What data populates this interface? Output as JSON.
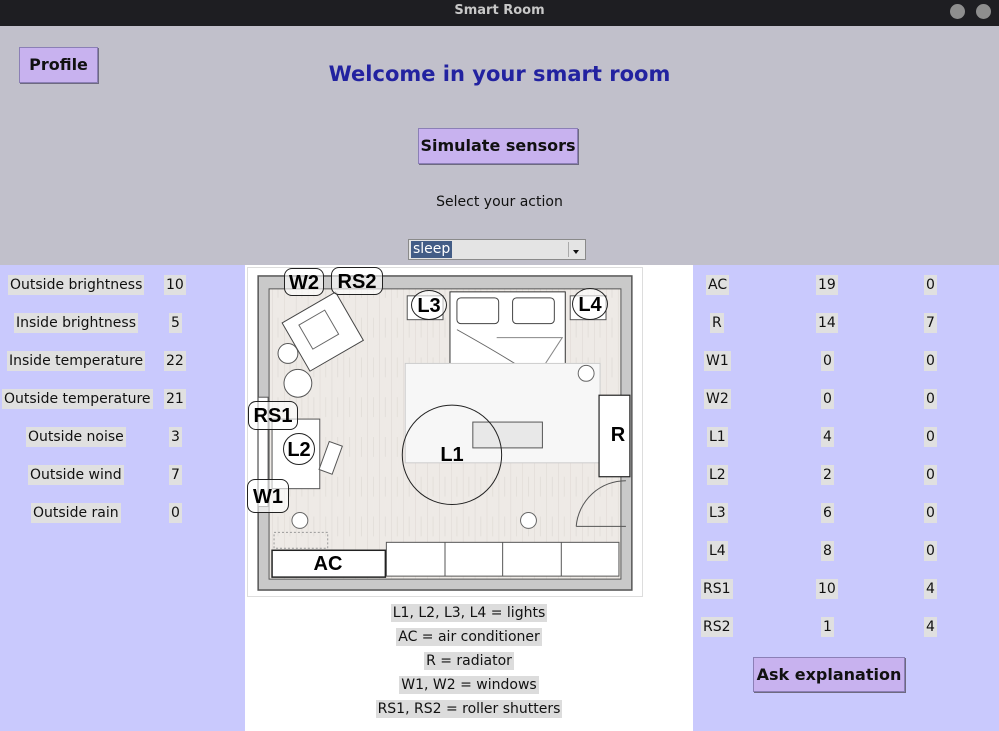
{
  "window": {
    "title": "Smart Room"
  },
  "header": {
    "profile_label": "Profile",
    "welcome": "Welcome in your smart room",
    "simulate_label": "Simulate sensors",
    "select_label": "Select your action",
    "action_selected": "sleep"
  },
  "sensors": [
    {
      "label": "Outside brightness",
      "value": "10"
    },
    {
      "label": "Inside brightness",
      "value": "5"
    },
    {
      "label": "Inside temperature",
      "value": "22"
    },
    {
      "label": "Outside temperature",
      "value": "21"
    },
    {
      "label": "Outside noise",
      "value": "3"
    },
    {
      "label": "Outside wind",
      "value": "7"
    },
    {
      "label": "Outside rain",
      "value": "0"
    }
  ],
  "devices": [
    {
      "name": "AC",
      "value1": "19",
      "value2": "0"
    },
    {
      "name": "R",
      "value1": "14",
      "value2": "7"
    },
    {
      "name": "W1",
      "value1": "0",
      "value2": "0"
    },
    {
      "name": "W2",
      "value1": "0",
      "value2": "0"
    },
    {
      "name": "L1",
      "value1": "4",
      "value2": "0"
    },
    {
      "name": "L2",
      "value1": "2",
      "value2": "0"
    },
    {
      "name": "L3",
      "value1": "6",
      "value2": "0"
    },
    {
      "name": "L4",
      "value1": "8",
      "value2": "0"
    },
    {
      "name": "RS1",
      "value1": "10",
      "value2": "4"
    },
    {
      "name": "RS2",
      "value1": "1",
      "value2": "4"
    }
  ],
  "ask_label": "Ask explanation",
  "floorplan": {
    "labels": {
      "W2": "W2",
      "RS2": "RS2",
      "L3": "L3",
      "L4": "L4",
      "RS1": "RS1",
      "L2": "L2",
      "L1": "L1",
      "R": "R",
      "W1": "W1",
      "AC": "AC"
    }
  },
  "legend": [
    "L1, L2, L3, L4 = lights",
    "AC = air conditioner",
    "R = radiator",
    "W1, W2 = windows",
    "RS1, RS2 = roller shutters"
  ],
  "colors": {
    "accent": "#c8b2ef",
    "panel": "#c9c9fd",
    "header_bg": "#c1c0cb",
    "title_text": "#2222a0"
  }
}
